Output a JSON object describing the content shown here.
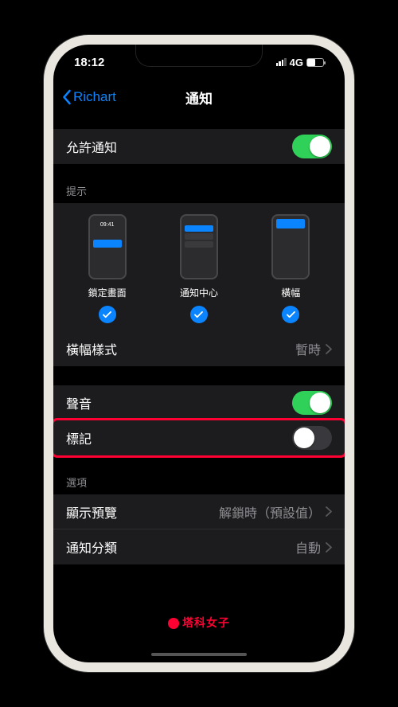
{
  "status": {
    "time": "18:12",
    "network": "4G"
  },
  "nav": {
    "back": "Richart",
    "title": "通知"
  },
  "allow": {
    "label": "允許通知",
    "on": true
  },
  "alerts": {
    "header": "提示",
    "options": [
      {
        "label": "鎖定畫面",
        "checked": true,
        "time": "09:41"
      },
      {
        "label": "通知中心",
        "checked": true
      },
      {
        "label": "橫幅",
        "checked": true
      }
    ]
  },
  "banner_style": {
    "label": "橫幅樣式",
    "value": "暫時"
  },
  "sound": {
    "label": "聲音",
    "on": true
  },
  "badge": {
    "label": "標記",
    "on": false
  },
  "options": {
    "header": "選項",
    "preview": {
      "label": "顯示預覽",
      "value": "解鎖時（預設值）"
    },
    "grouping": {
      "label": "通知分類",
      "value": "自動"
    }
  },
  "watermark": "塔科女子"
}
